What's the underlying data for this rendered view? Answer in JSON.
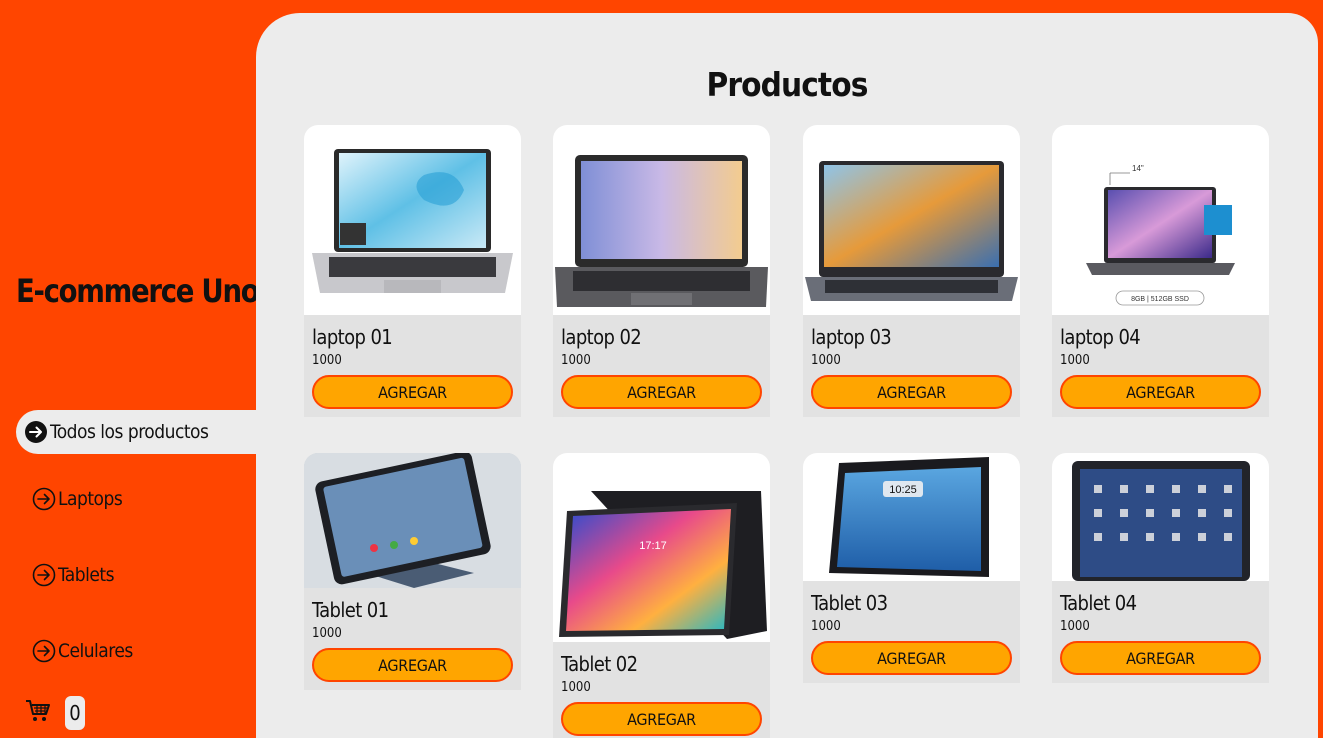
{
  "sidebar": {
    "brand": "E-commerce Uno",
    "nav": [
      {
        "label": "Todos los productos"
      },
      {
        "label": "Laptops"
      },
      {
        "label": "Tablets"
      },
      {
        "label": "Celulares"
      }
    ],
    "cart_count": "0"
  },
  "main": {
    "title": "Productos",
    "products": [
      {
        "name": "laptop 01",
        "price": "1000",
        "button": "AGREGAR"
      },
      {
        "name": "laptop 02",
        "price": "1000",
        "button": "AGREGAR"
      },
      {
        "name": "laptop 03",
        "price": "1000",
        "button": "AGREGAR"
      },
      {
        "name": "laptop 04",
        "price": "1000",
        "button": "AGREGAR",
        "image_text_1": "14\"",
        "image_text_2": "8GB | 512GB SSD"
      },
      {
        "name": "Tablet 01",
        "price": "1000",
        "button": "AGREGAR"
      },
      {
        "name": "Tablet 02",
        "price": "1000",
        "button": "AGREGAR",
        "image_text": "17:17"
      },
      {
        "name": "Tablet 03",
        "price": "1000",
        "button": "AGREGAR",
        "image_text": "10:25"
      },
      {
        "name": "Tablet 04",
        "price": "1000",
        "button": "AGREGAR"
      }
    ]
  },
  "colors": {
    "background": "#ff4500",
    "panel": "#ececec",
    "card_footer": "#e2e2e2",
    "button": "#ffa500",
    "button_border": "#ff4500"
  }
}
